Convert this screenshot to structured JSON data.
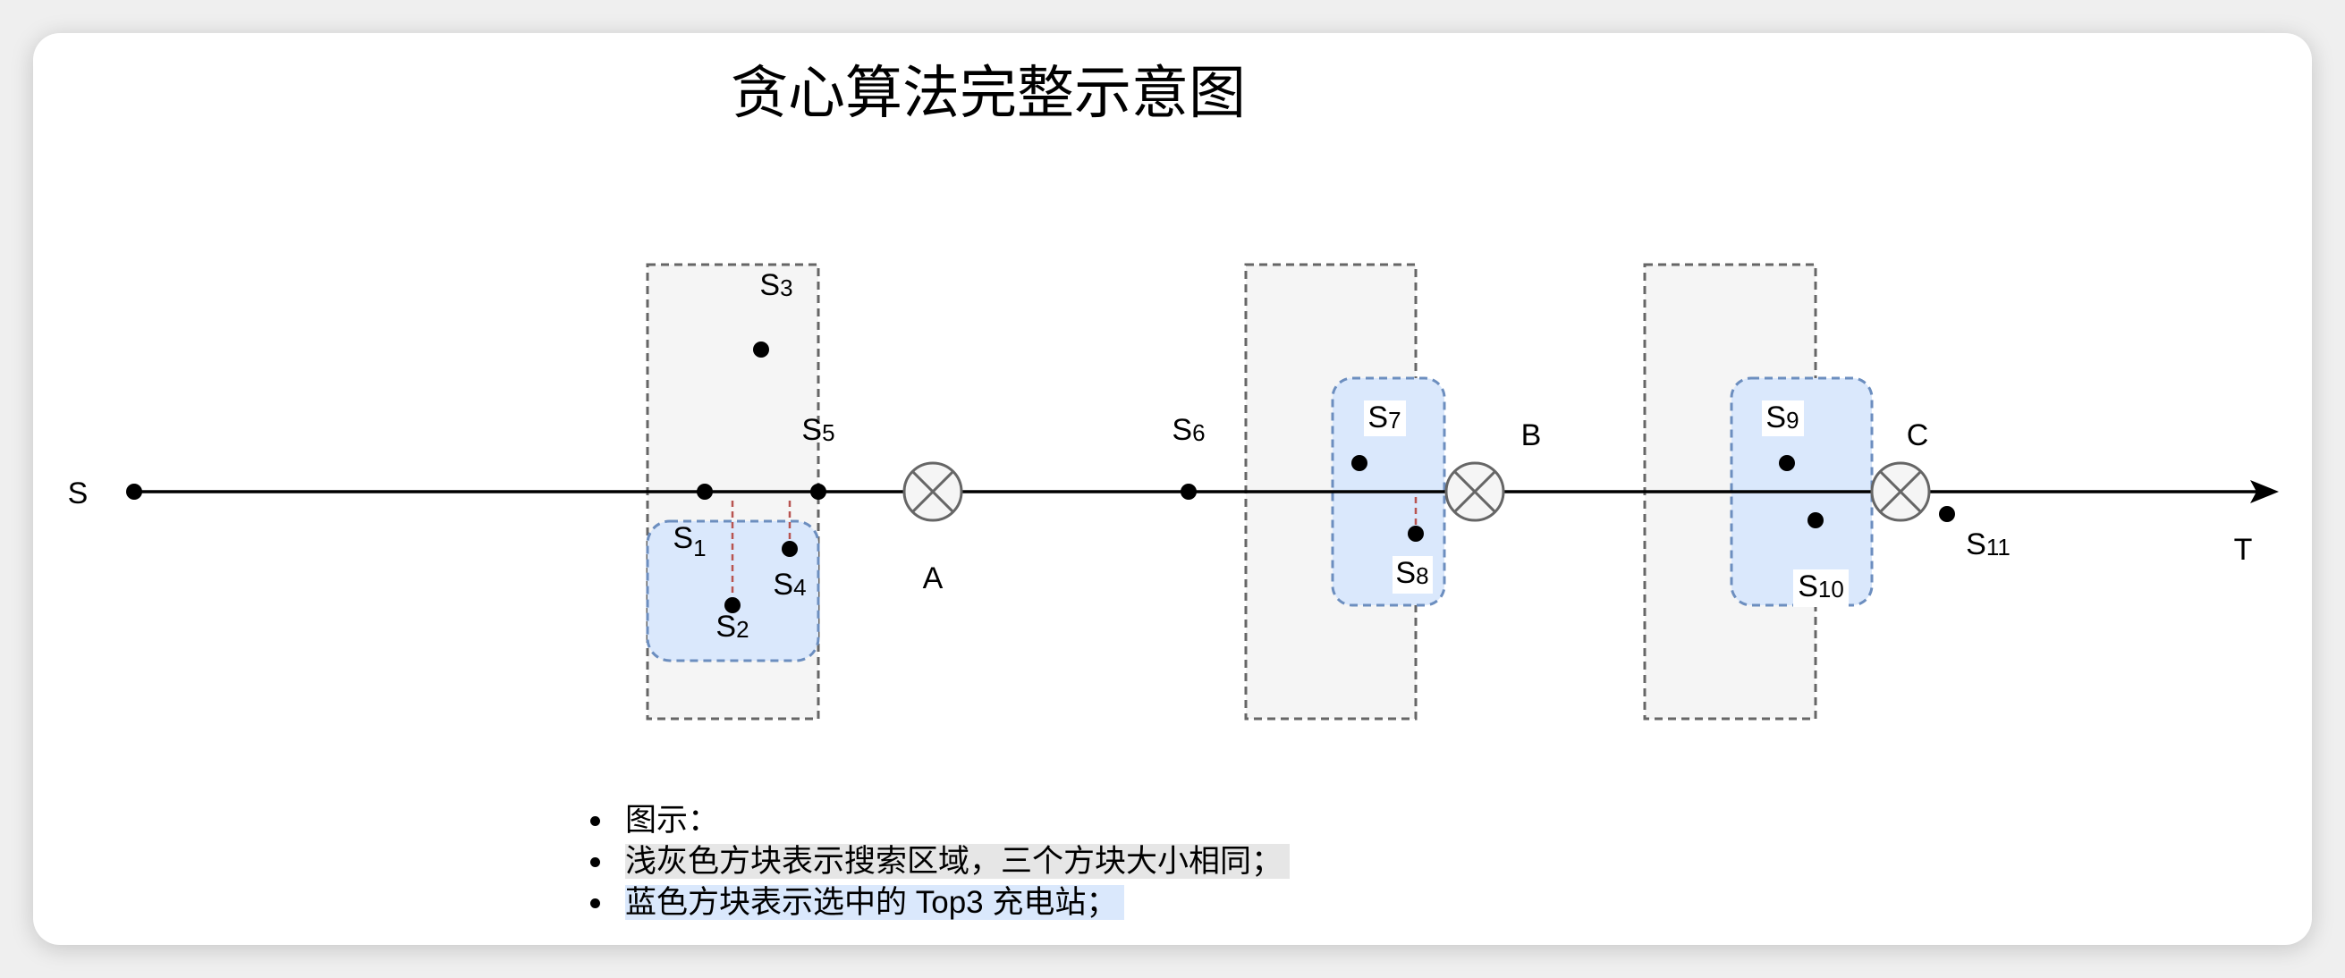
{
  "title": "贪心算法完整示意图",
  "route": {
    "start_label": "S",
    "end_label": "T"
  },
  "stations": {
    "a": "A",
    "b": "B",
    "c": "C"
  },
  "points": {
    "s1": {
      "base": "S",
      "sub": "1"
    },
    "s2": {
      "base": "S",
      "sub": "2"
    },
    "s3": {
      "base": "S",
      "sub": "3"
    },
    "s4": {
      "base": "S",
      "sub": "4"
    },
    "s5": {
      "base": "S",
      "sub": "5"
    },
    "s6": {
      "base": "S",
      "sub": "6"
    },
    "s7": {
      "base": "S",
      "sub": "7"
    },
    "s8": {
      "base": "S",
      "sub": "8"
    },
    "s9": {
      "base": "S",
      "sub": "9"
    },
    "s10": {
      "base": "S",
      "sub": "10"
    },
    "s11": {
      "base": "S",
      "sub": "11"
    }
  },
  "legend": {
    "heading": "图示：",
    "items": [
      "浅灰色方块表示搜索区域，三个方块大小相同；",
      "蓝色方块表示选中的 Top3 充电站；"
    ]
  },
  "colors": {
    "search_area_fill": "#f5f5f5",
    "selected_fill": "#dae8fc",
    "selected_stroke": "#6c8ebf",
    "link_color": "#b85450",
    "legend_gray_highlight": "#e6e6e6",
    "legend_blue_highlight": "#dae8fc"
  }
}
